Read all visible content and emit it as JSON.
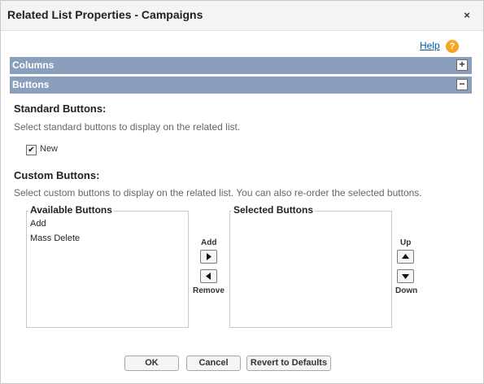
{
  "dialog": {
    "title": "Related List Properties - Campaigns",
    "close": "×"
  },
  "help": {
    "label": "Help",
    "icon": "?"
  },
  "sections": {
    "columns": {
      "label": "Columns",
      "toggle": "+"
    },
    "buttons": {
      "label": "Buttons",
      "toggle": "−"
    }
  },
  "standard": {
    "heading": "Standard Buttons:",
    "description": "Select standard buttons to display on the related list.",
    "new_label": "New",
    "new_checked": true
  },
  "custom": {
    "heading": "Custom Buttons:",
    "description": "Select custom buttons to display on the related list. You can also re-order the selected buttons.",
    "available": {
      "label": "Available Buttons",
      "items": [
        "Add",
        "Mass Delete"
      ]
    },
    "selected": {
      "label": "Selected Buttons",
      "items": []
    },
    "add_label": "Add",
    "remove_label": "Remove",
    "up_label": "Up",
    "down_label": "Down"
  },
  "footer": {
    "ok": "OK",
    "cancel": "Cancel",
    "revert": "Revert to Defaults"
  },
  "colors": {
    "section_bar": "#8a9ebe",
    "link": "#015ba7",
    "help_icon": "#f5a623"
  }
}
